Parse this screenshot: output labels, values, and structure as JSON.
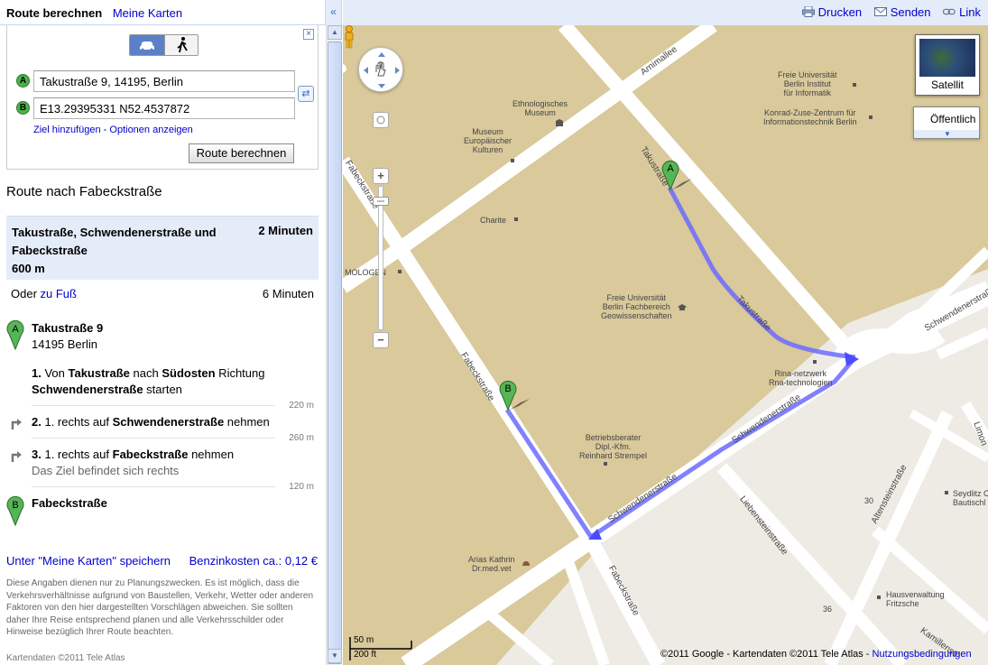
{
  "header": {
    "tab_route": "Route berechnen",
    "tab_maps": "Meine Karten",
    "collapse_label": "«",
    "links": {
      "print": "Drucken",
      "send": "Senden",
      "link": "Link"
    }
  },
  "directions_form": {
    "waypoint_a_badge": "A",
    "waypoint_b_badge": "B",
    "waypoint_a_value": "Takustraße 9, 14195, Berlin",
    "waypoint_b_value": "E13.29395331 N52.4537872",
    "add_destination": "Ziel hinzufügen",
    "options_separator": " - ",
    "show_options": "Optionen anzeigen",
    "submit_label": "Route berechnen",
    "close_label": "×",
    "swap_label": "⇄"
  },
  "route": {
    "title": "Route nach Fabeckstraße",
    "summary_name": "Takustraße, Schwendenerstraße und Fabeckstraße",
    "summary_distance": "600 m",
    "summary_time": "2 Minuten",
    "walk_prefix": "Oder ",
    "walk_link": "zu Fuß",
    "walk_time": "6 Minuten",
    "start_name": "Takustraße 9",
    "start_city": "14195 Berlin",
    "steps": [
      {
        "num": "1.",
        "parts": [
          "Von ",
          "Takustraße",
          " nach ",
          "Südosten",
          " Richtung ",
          "Schwendenerstraße",
          " starten"
        ],
        "distance": "220 m"
      },
      {
        "num": "2.",
        "parts": [
          "1. rechts auf ",
          "Schwendenerstraße",
          " nehmen"
        ],
        "distance": "260 m"
      },
      {
        "num": "3.",
        "parts": [
          "1. rechts auf ",
          "Fabeckstraße",
          " nehmen"
        ],
        "note": "Das Ziel befindet sich rechts",
        "distance": "120 m"
      }
    ],
    "end_name": "Fabeckstraße"
  },
  "footer_left": {
    "save_link": "Unter \"Meine Karten\" speichern",
    "fuel_cost": "Benzinkosten ca.: 0,12 €",
    "disclaimer": "Diese Angaben dienen nur zu Planungszwecken. Es ist möglich, dass die Verkehrsverhältnisse aufgrund von Baustellen, Verkehr, Wetter oder anderen Faktoren von den hier dargestellten Vorschlägen abweichen. Sie sollten daher Ihre Reise entsprechend planen und alle Verkehrsschilder oder Hinweise bezüglich Ihrer Route beachten.",
    "map_data": "Kartendaten ©2011 Tele Atlas"
  },
  "map": {
    "satellite_label": "Satellit",
    "public_transport_label": "Öffentlich",
    "zoom_in": "+",
    "zoom_out": "−",
    "scale_metric": "50 m",
    "scale_imperial": "200 ft",
    "copyright": "©2011 Google - Kartendaten ©2011 Tele Atlas - ",
    "terms_link": "Nutzungsbedingungen",
    "marker_a": "A",
    "marker_b": "B",
    "streets": {
      "arnimallee": "Arnimallee",
      "takustrasse_1": "Takustraße",
      "takustrasse_2": "Takustraße",
      "fabeckstrasse_1": "Fabeckstraße",
      "fabeckstrasse_2": "Fabeckstraße",
      "fabeckstrasse_3": "Fabeckstraße",
      "schwendenerstrasse_1": "Schwendenerstraße",
      "schwendenerstrasse_2": "Schwendenerstraße",
      "schwendenerstrasse_3": "Schwendenerstraße",
      "altensteinstrasse": "Altensteinstraße",
      "liebensteinstrasse": "Liebensteinstraße",
      "limonenstrasse": "Limon",
      "kamillenstrasse": "Kamillenstr",
      "num_30": "30",
      "num_36": "36"
    },
    "pois": {
      "fu_inf": "Freie Universität\nBerlin Institut\nfür Informatik",
      "zib": "Konrad-Zuse-Zentrum für\nInformationstechnik Berlin",
      "ethno": "Ethnologisches\nMuseum",
      "museum_eu": "Museum\nEuropäischer\nKulturen",
      "charite": "Charite",
      "mologen": "MOLOGEN",
      "fu_geo": "Freie Universität\nBerlin Fachbereich\nGeowissenschaften",
      "rina": "Rina-netzwerk\nRna-technologien",
      "strempel": "Betriebsberater\nDipl.-Kfm.\nReinhard Strempel",
      "arias": "Arias Kathrin\nDr.med.vet",
      "hausverwaltung": "Hausverwaltung\nFritzsche",
      "seydlitz": "Seydlitz Carl v\nBautischl"
    }
  }
}
